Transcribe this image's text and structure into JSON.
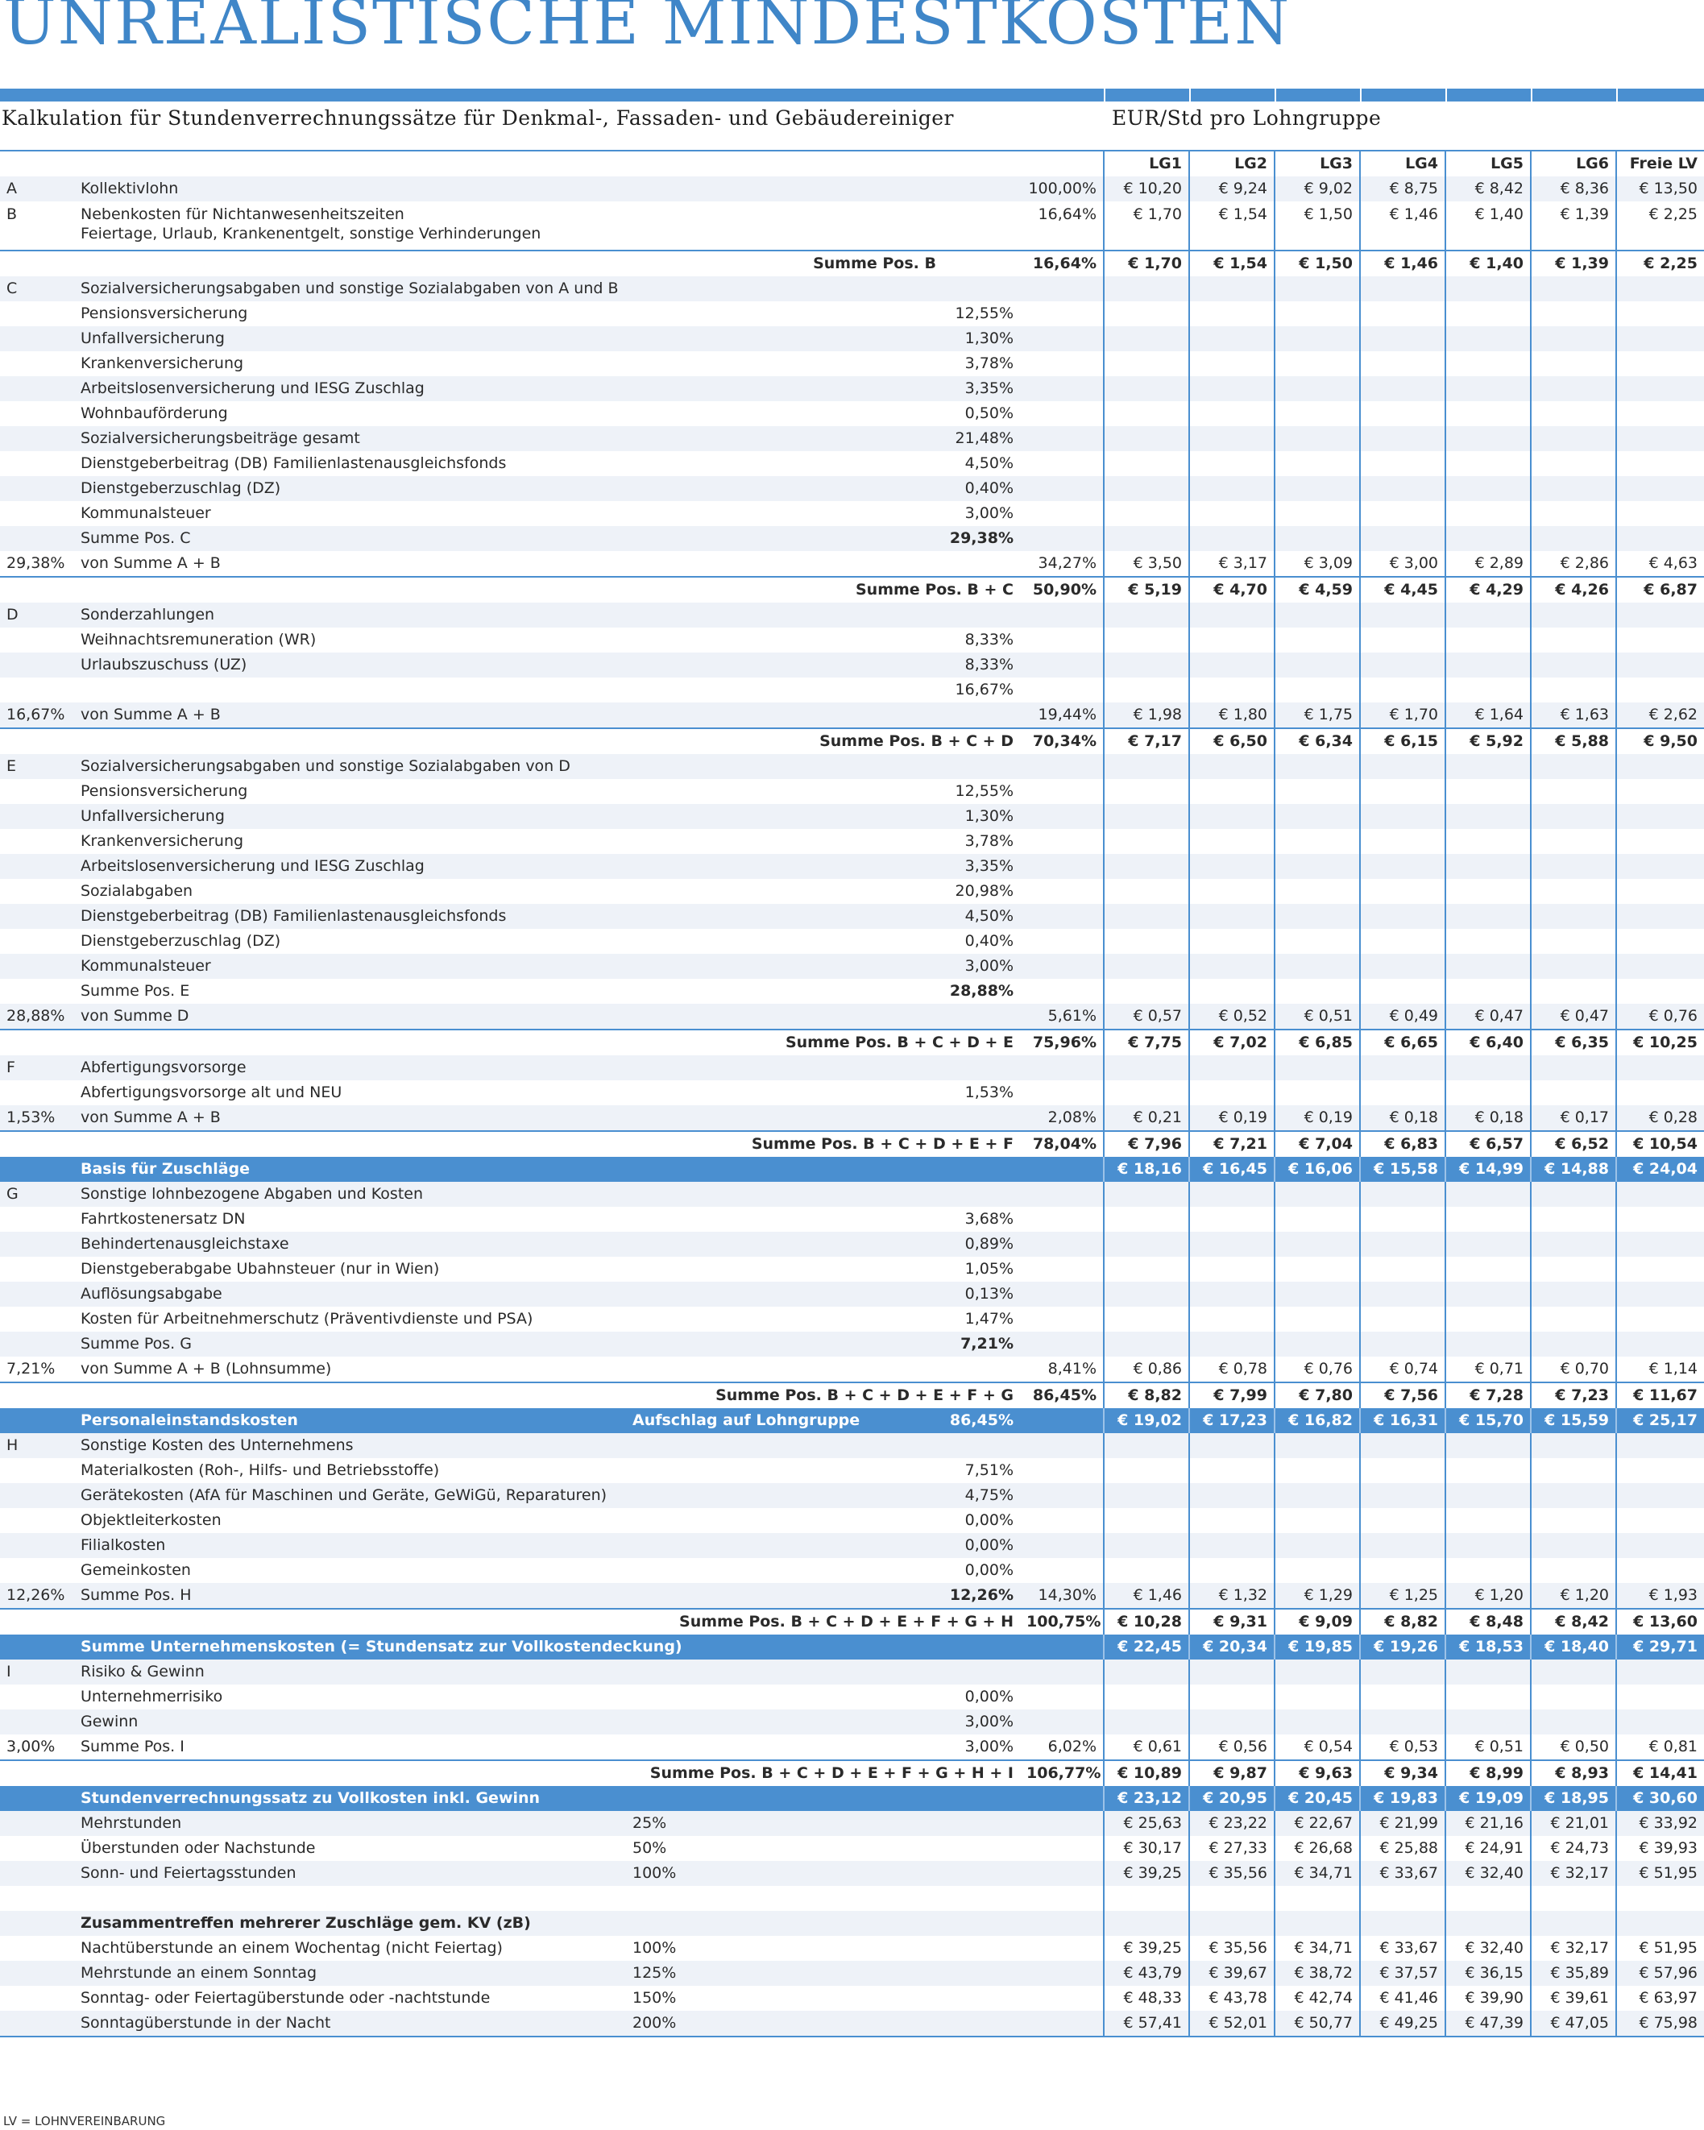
{
  "page": {
    "title": "UNREALISTISCHE MINDESTKOSTEN",
    "subtitle": "Kalkulation für Stundenverrechnungssätze für Denkmal-, Fassaden- und Gebäudereiniger",
    "unit_header": "EUR/Std pro Lohngruppe",
    "footnote": "LV = LOHNVEREINBARUNG"
  },
  "columns": [
    "LG1",
    "LG2",
    "LG3",
    "LG4",
    "LG5",
    "LG6",
    "Freie LV"
  ],
  "rows": [
    {
      "t": "hdr",
      "v": [
        "LG1",
        "LG2",
        "LG3",
        "LG4",
        "LG5",
        "LG6",
        "Freie LV"
      ]
    },
    {
      "a": "A",
      "d": "Kollektivlohn",
      "p2": "100,00%",
      "v": [
        "€ 10,20",
        "€ 9,24",
        "€ 9,02",
        "€ 8,75",
        "€ 8,42",
        "€ 8,36",
        "€ 13,50"
      ]
    },
    {
      "t": "tall",
      "a": "B",
      "d": "Nebenkosten für Nichtanwesenheitszeiten",
      "d2": "Feiertage, Urlaub, Krankenentgelt, sonstige Verhinderungen",
      "p2": "16,64%",
      "v": [
        "€ 1,70",
        "€ 1,54",
        "€ 1,50",
        "€ 1,46",
        "€ 1,40",
        "€ 1,39",
        "€ 2,25"
      ]
    },
    {
      "t": "sum",
      "m": "Summe Pos. B",
      "p2": "16,64%",
      "v": [
        "€ 1,70",
        "€ 1,54",
        "€ 1,50",
        "€ 1,46",
        "€ 1,40",
        "€ 1,39",
        "€ 2,25"
      ]
    },
    {
      "a": "C",
      "d": "Sozialversicherungsabgaben und sonstige Sozialabgaben von A und B"
    },
    {
      "d": "Pensionsversicherung",
      "p1": "12,55%"
    },
    {
      "d": "Unfallversicherung",
      "p1": "1,30%"
    },
    {
      "d": "Krankenversicherung",
      "p1": "3,78%"
    },
    {
      "d": "Arbeitslosenversicherung und IESG Zuschlag",
      "p1": "3,35%"
    },
    {
      "d": "Wohnbauförderung",
      "p1": "0,50%"
    },
    {
      "d": "Sozialversicherungsbeiträge gesamt",
      "p1": "21,48%"
    },
    {
      "d": "Dienstgeberbeitrag (DB) Familienlastenausgleichsfonds",
      "p1": "4,50%"
    },
    {
      "d": "Dienstgeberzuschlag (DZ)",
      "p1": "0,40%"
    },
    {
      "d": "Kommunalsteuer",
      "p1": "3,00%"
    },
    {
      "d": "Summe Pos. C",
      "p1": "29,38%",
      "p1b": true
    },
    {
      "a": "29,38%",
      "d": "von Summe A + B",
      "p2": "34,27%",
      "v": [
        "€ 3,50",
        "€ 3,17",
        "€ 3,09",
        "€ 3,00",
        "€ 2,89",
        "€ 2,86",
        "€ 4,63"
      ]
    },
    {
      "t": "sum",
      "m2": "Summe Pos. B + C",
      "p2": "50,90%",
      "v": [
        "€ 5,19",
        "€ 4,70",
        "€ 4,59",
        "€ 4,45",
        "€ 4,29",
        "€ 4,26",
        "€ 6,87"
      ]
    },
    {
      "a": "D",
      "d": "Sonderzahlungen"
    },
    {
      "d": "Weihnachtsremuneration (WR)",
      "p1": "8,33%"
    },
    {
      "d": "Urlaubszuschuss (UZ)",
      "p1": "8,33%"
    },
    {
      "p1": "16,67%"
    },
    {
      "a": "16,67%",
      "d": "von Summe A + B",
      "p2": "19,44%",
      "v": [
        "€ 1,98",
        "€ 1,80",
        "€ 1,75",
        "€ 1,70",
        "€ 1,64",
        "€ 1,63",
        "€ 2,62"
      ]
    },
    {
      "t": "sum",
      "m2": "Summe Pos. B + C + D",
      "p2": "70,34%",
      "v": [
        "€ 7,17",
        "€ 6,50",
        "€ 6,34",
        "€ 6,15",
        "€ 5,92",
        "€ 5,88",
        "€ 9,50"
      ]
    },
    {
      "a": "E",
      "d": "Sozialversicherungsabgaben und sonstige Sozialabgaben von D"
    },
    {
      "d": "Pensionsversicherung",
      "p1": "12,55%"
    },
    {
      "d": "Unfallversicherung",
      "p1": "1,30%"
    },
    {
      "d": "Krankenversicherung",
      "p1": "3,78%"
    },
    {
      "d": "Arbeitslosenversicherung und IESG Zuschlag",
      "p1": "3,35%"
    },
    {
      "d": "Sozialabgaben",
      "p1": "20,98%"
    },
    {
      "d": "Dienstgeberbeitrag (DB) Familienlastenausgleichsfonds",
      "p1": "4,50%"
    },
    {
      "d": "Dienstgeberzuschlag (DZ)",
      "p1": "0,40%"
    },
    {
      "d": "Kommunalsteuer",
      "p1": "3,00%"
    },
    {
      "d": "Summe Pos. E",
      "p1": "28,88%",
      "p1b": true
    },
    {
      "a": "28,88%",
      "d": "von Summe D",
      "p2": "5,61%",
      "v": [
        "€ 0,57",
        "€ 0,52",
        "€ 0,51",
        "€ 0,49",
        "€ 0,47",
        "€ 0,47",
        "€ 0,76"
      ]
    },
    {
      "t": "sum",
      "m2": "Summe Pos. B + C + D + E",
      "p2": "75,96%",
      "v": [
        "€ 7,75",
        "€ 7,02",
        "€ 6,85",
        "€ 6,65",
        "€ 6,40",
        "€ 6,35",
        "€ 10,25"
      ]
    },
    {
      "a": "F",
      "d": "Abfertigungsvorsorge"
    },
    {
      "d": "Abfertigungsvorsorge alt und NEU",
      "p1": "1,53%"
    },
    {
      "a": "1,53%",
      "d": "von Summe A + B",
      "p2": "2,08%",
      "v": [
        "€ 0,21",
        "€ 0,19",
        "€ 0,19",
        "€ 0,18",
        "€ 0,18",
        "€ 0,17",
        "€ 0,28"
      ]
    },
    {
      "t": "sum",
      "m2": "Summe Pos. B + C + D + E + F",
      "p2": "78,04%",
      "v": [
        "€ 7,96",
        "€ 7,21",
        "€ 7,04",
        "€ 6,83",
        "€ 6,57",
        "€ 6,52",
        "€ 10,54"
      ]
    },
    {
      "t": "band",
      "d": "Basis für Zuschläge",
      "v": [
        "€ 18,16",
        "€ 16,45",
        "€ 16,06",
        "€ 15,58",
        "€ 14,99",
        "€ 14,88",
        "€ 24,04"
      ]
    },
    {
      "a": "G",
      "d": "Sonstige lohnbezogene Abgaben und Kosten"
    },
    {
      "d": "Fahrtkostenersatz DN",
      "p1": "3,68%"
    },
    {
      "d": "Behindertenausgleichstaxe",
      "p1": "0,89%"
    },
    {
      "d": "Dienstgeberabgabe Ubahnsteuer (nur in Wien)",
      "p1": "1,05%"
    },
    {
      "d": "Auflösungsabgabe",
      "p1": "0,13%"
    },
    {
      "d": "Kosten für Arbeitnehmerschutz (Präventivdienste und PSA)",
      "p1": "1,47%"
    },
    {
      "d": "Summe Pos. G",
      "p1": "7,21%",
      "p1b": true
    },
    {
      "a": "7,21%",
      "d": "von Summe A + B (Lohnsumme)",
      "p2": "8,41%",
      "v": [
        "€ 0,86",
        "€ 0,78",
        "€ 0,76",
        "€ 0,74",
        "€ 0,71",
        "€ 0,70",
        "€ 1,14"
      ]
    },
    {
      "t": "sum",
      "m2": "Summe Pos. B + C + D + E + F + G",
      "p2": "86,45%",
      "v": [
        "€ 8,82",
        "€ 7,99",
        "€ 7,80",
        "€ 7,56",
        "€ 7,28",
        "€ 7,23",
        "€ 11,67"
      ]
    },
    {
      "t": "band",
      "d": "Personaleinstandskosten",
      "m": "Aufschlag auf Lohngruppe",
      "p1": "86,45%",
      "v": [
        "€ 19,02",
        "€ 17,23",
        "€ 16,82",
        "€ 16,31",
        "€ 15,70",
        "€ 15,59",
        "€ 25,17"
      ]
    },
    {
      "a": "H",
      "d": "Sonstige Kosten des Unternehmens"
    },
    {
      "d": "Materialkosten (Roh-, Hilfs- und Betriebsstoffe)",
      "p1": "7,51%"
    },
    {
      "d": "Gerätekosten (AfA für Maschinen und Geräte, GeWiGü, Reparaturen)",
      "p1": "4,75%"
    },
    {
      "d": "Objektleiterkosten",
      "p1": "0,00%"
    },
    {
      "d": "Filialkosten",
      "p1": "0,00%"
    },
    {
      "d": "Gemeinkosten",
      "p1": "0,00%"
    },
    {
      "a": "12,26%",
      "d": "Summe Pos. H",
      "p1": "12,26%",
      "p1b": true,
      "p2": "14,30%",
      "v": [
        "€ 1,46",
        "€ 1,32",
        "€ 1,29",
        "€ 1,25",
        "€ 1,20",
        "€ 1,20",
        "€ 1,93"
      ]
    },
    {
      "t": "sum",
      "m2": "Summe Pos. B + C + D + E + F + G + H",
      "p2": "100,75%",
      "v": [
        "€ 10,28",
        "€ 9,31",
        "€ 9,09",
        "€ 8,82",
        "€ 8,48",
        "€ 8,42",
        "€ 13,60"
      ]
    },
    {
      "t": "band",
      "d": "Summe Unternehmenskosten (= Stundensatz zur Vollkostendeckung)",
      "v": [
        "€ 22,45",
        "€ 20,34",
        "€ 19,85",
        "€ 19,26",
        "€ 18,53",
        "€ 18,40",
        "€ 29,71"
      ]
    },
    {
      "a": "I",
      "d": "Risiko & Gewinn"
    },
    {
      "d": "Unternehmerrisiko",
      "p1": "0,00%"
    },
    {
      "d": "Gewinn",
      "p1": "3,00%"
    },
    {
      "a": "3,00%",
      "d": "Summe Pos. I",
      "p1": "3,00%",
      "p2": "6,02%",
      "v": [
        "€ 0,61",
        "€ 0,56",
        "€ 0,54",
        "€ 0,53",
        "€ 0,51",
        "€ 0,50",
        "€ 0,81"
      ]
    },
    {
      "t": "sum",
      "m2": "Summe Pos. B + C + D + E + F + G + H + I",
      "p2": "106,77%",
      "v": [
        "€ 10,89",
        "€ 9,87",
        "€ 9,63",
        "€ 9,34",
        "€ 8,99",
        "€ 8,93",
        "€ 14,41"
      ]
    },
    {
      "t": "band",
      "d": "Stundenverrechnungssatz zu Vollkosten inkl. Gewinn",
      "v": [
        "€ 23,12",
        "€ 20,95",
        "€ 20,45",
        "€ 19,83",
        "€ 19,09",
        "€ 18,95",
        "€ 30,60"
      ]
    },
    {
      "d": "Mehrstunden",
      "m": "25%",
      "v": [
        "€ 25,63",
        "€ 23,22",
        "€ 22,67",
        "€ 21,99",
        "€ 21,16",
        "€ 21,01",
        "€ 33,92"
      ]
    },
    {
      "d": "Überstunden oder Nachstunde",
      "m": "50%",
      "v": [
        "€ 30,17",
        "€ 27,33",
        "€ 26,68",
        "€ 25,88",
        "€ 24,91",
        "€ 24,73",
        "€ 39,93"
      ]
    },
    {
      "d": "Sonn- und Feiertagsstunden",
      "m": "100%",
      "v": [
        "€ 39,25",
        "€ 35,56",
        "€ 34,71",
        "€ 33,67",
        "€ 32,40",
        "€ 32,17",
        "€ 51,95"
      ]
    },
    {},
    {
      "d": "Zusammentreffen mehrerer Zuschläge gem. KV (zB)",
      "db": true
    },
    {
      "d": "Nachtüberstunde an einem Wochentag (nicht Feiertag)",
      "m": "100%",
      "v": [
        "€ 39,25",
        "€ 35,56",
        "€ 34,71",
        "€ 33,67",
        "€ 32,40",
        "€ 32,17",
        "€ 51,95"
      ]
    },
    {
      "d": "Mehrstunde an einem Sonntag",
      "m": "125%",
      "v": [
        "€ 43,79",
        "€ 39,67",
        "€ 38,72",
        "€ 37,57",
        "€ 36,15",
        "€ 35,89",
        "€ 57,96"
      ]
    },
    {
      "d": "Sonntag- oder Feiertagüberstunde oder -nachtstunde",
      "m": "150%",
      "v": [
        "€ 48,33",
        "€ 43,78",
        "€ 42,74",
        "€ 41,46",
        "€ 39,90",
        "€ 39,61",
        "€ 63,97"
      ]
    },
    {
      "t": "bottom",
      "d": "Sonntagüberstunde in der Nacht",
      "m": "200%",
      "v": [
        "€ 57,41",
        "€ 52,01",
        "€ 50,77",
        "€ 49,25",
        "€ 47,39",
        "€ 47,05",
        "€ 75,98"
      ]
    }
  ]
}
